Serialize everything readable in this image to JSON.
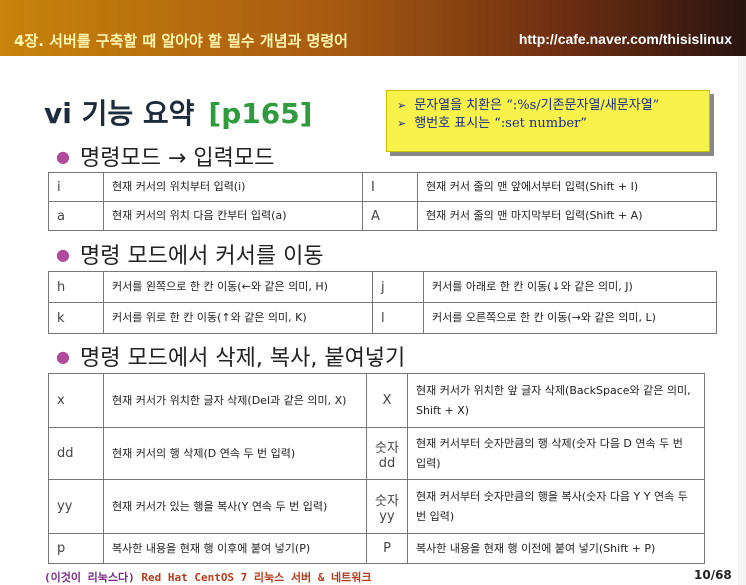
{
  "header": {
    "chapter": "4장. 서버를 구축할 때 알아야 할 필수 개념과 명령어",
    "url": "http://cafe.naver.com/thisislinux"
  },
  "title": {
    "text": "vi 기능 요약",
    "page": "[p165]"
  },
  "note": {
    "line1": "문자열을 치환은 “:%s/기존문자열/새문자열”",
    "line2": "행번호 표시는 “:set number”"
  },
  "section1": {
    "heading": "명령모드 → 입력모드",
    "rows": [
      {
        "k1": "i",
        "d1": "현재 커서의 위치부터 입력(i)",
        "k2": "I",
        "d2": "현재 커서 줄의 맨 앞에서부터 입력(Shift + I)"
      },
      {
        "k1": "a",
        "d1": "현재 커서의 위치 다음 칸부터 입력(a)",
        "k2": "A",
        "d2": "현재 커서 줄의 맨 마지막부터 입력(Shift + A)"
      }
    ]
  },
  "section2": {
    "heading": "명령 모드에서 커서를 이동",
    "rows": [
      {
        "k1": "h",
        "d1": "커서를 왼쪽으로 한 칸 이동(←와 같은 의미, H)",
        "k2": "j",
        "d2": "커서를 아래로 한 칸 이동(↓와 같은 의미, J)"
      },
      {
        "k1": "k",
        "d1": "커서를 위로 한 칸 이동(↑와 같은 의미, K)",
        "k2": "l",
        "d2": "커서를 오른쪽으로 한 칸 이동(→와 같은 의미, L)"
      }
    ]
  },
  "section3": {
    "heading": "명령 모드에서 삭제, 복사, 붙여넣기",
    "rows": [
      {
        "k1": "x",
        "d1": "현재 커서가 위치한 글자 삭제(Del과 같은 의미, X)",
        "k2": "X",
        "d2": "현재 커서가 위치한 앞 글자 삭제(BackSpace와 같은 의미, Shift + X)"
      },
      {
        "k1": "dd",
        "d1": "현재 커서의 행 삭제(D 연속 두 번 입력)",
        "k2": "숫자 dd",
        "d2": "현재 커서부터 숫자만큼의 행 삭제(숫자 다음 D 연속 두 번 입력)"
      },
      {
        "k1": "yy",
        "d1": "현재 커서가 있는 행을 복사(Y 연속 두 번 입력)",
        "k2": "숫자 yy",
        "d2": "현재 커서부터 숫자만큼의 행을 복사(숫자 다음 Y Y 연속 두 번 입력)"
      },
      {
        "k1": "p",
        "d1": "복사한 내용을 현재 행 이후에 붙여 넣기(P)",
        "k2": "P",
        "d2": "복사한 내용을 현재 행 이전에 붙여 넣기(Shift + P)"
      }
    ]
  },
  "footer": {
    "book_prefix": "(이것이 리눅스다)",
    "book_rest": "Red Hat CentOS 7 리눅스 서버 & 네트워크",
    "page": "10/68"
  }
}
